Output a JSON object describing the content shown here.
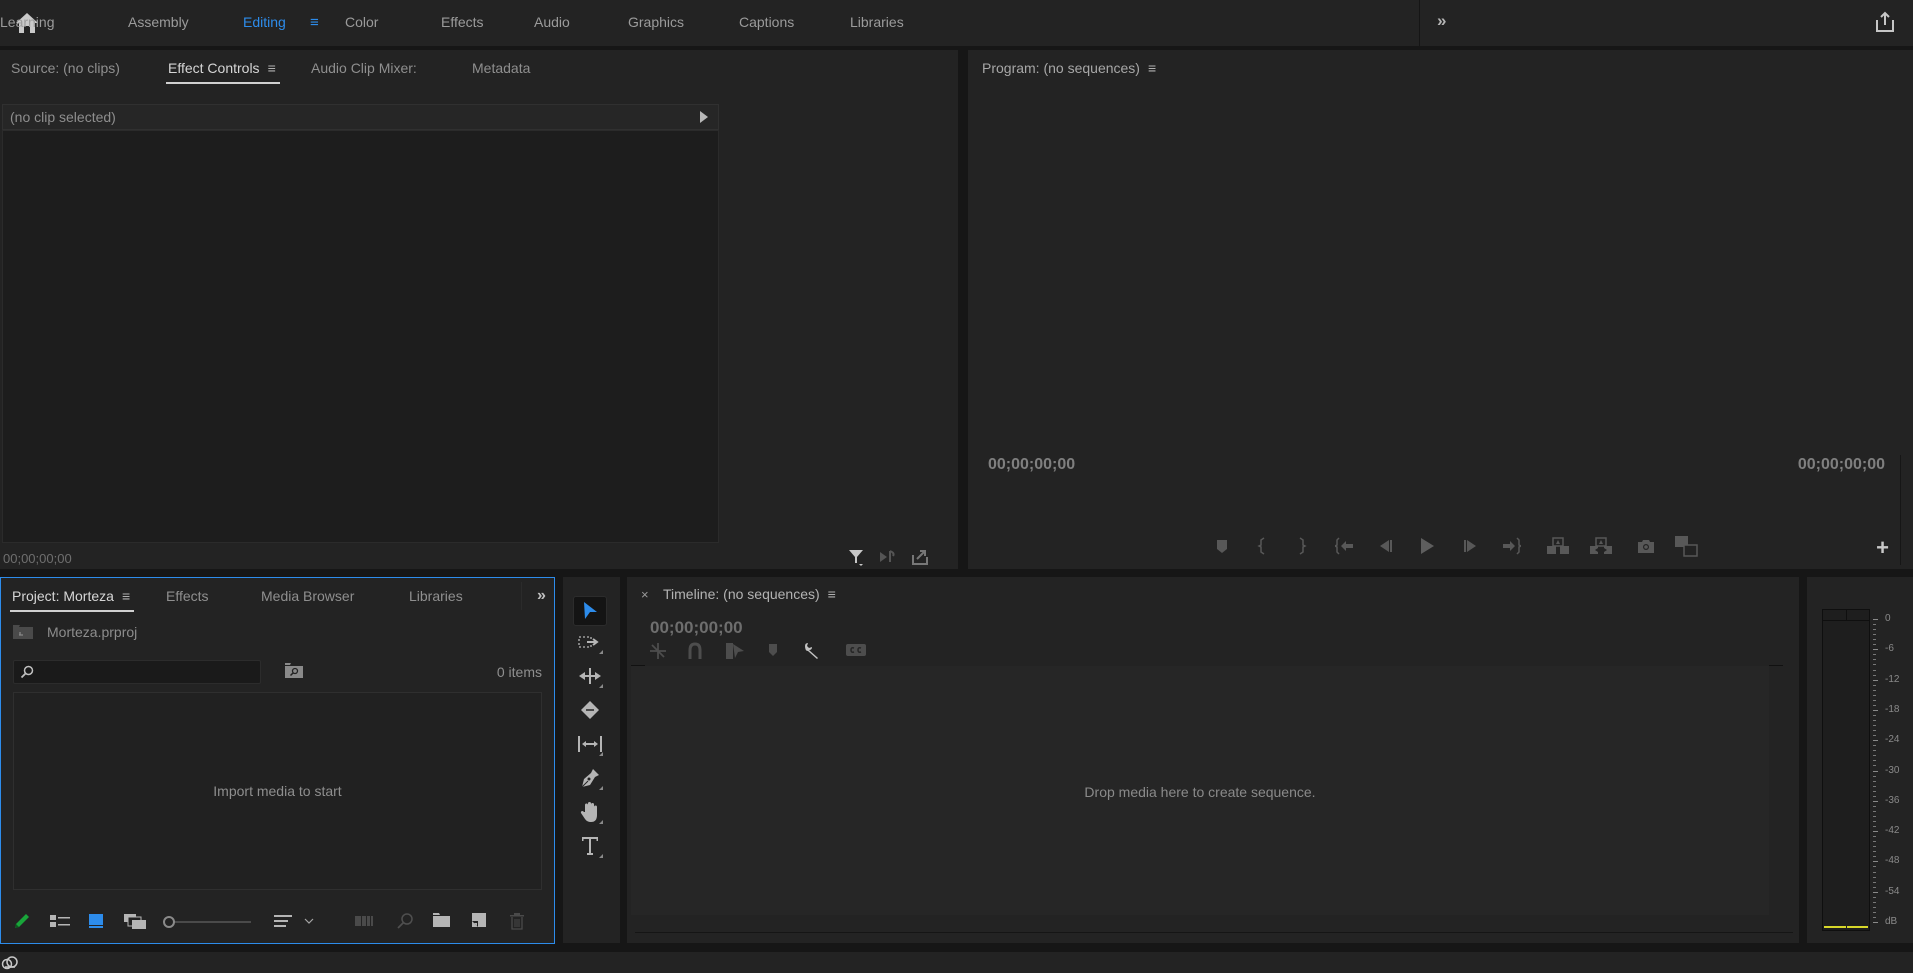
{
  "topbar": {
    "workspaces": [
      {
        "label": "Learning",
        "active": false
      },
      {
        "label": "Assembly",
        "active": false
      },
      {
        "label": "Editing",
        "active": true
      },
      {
        "label": "Color",
        "active": false
      },
      {
        "label": "Effects",
        "active": false
      },
      {
        "label": "Audio",
        "active": false
      },
      {
        "label": "Graphics",
        "active": false
      },
      {
        "label": "Captions",
        "active": false
      },
      {
        "label": "Libraries",
        "active": false
      }
    ],
    "workspace_menu_icon": "hamburger-icon",
    "overflow_icon": "double-chevron-right-icon",
    "home_icon": "home-icon",
    "share_icon": "share-export-icon",
    "accent_color": "#2d8ceb"
  },
  "source_panel": {
    "tabs": [
      {
        "label": "Source: (no clips)",
        "active": false
      },
      {
        "label": "Effect Controls",
        "active": true
      },
      {
        "label": "Audio Clip Mixer:",
        "active": false
      },
      {
        "label": "Metadata",
        "active": false
      }
    ],
    "clip_header": "(no clip selected)",
    "timecode": "00;00;00;00",
    "footer_icons": [
      "filter-icon",
      "play-audio-icon",
      "export-icon"
    ]
  },
  "program_panel": {
    "title": "Program: (no sequences)",
    "timecode_left": "00;00;00;00",
    "timecode_right": "00;00;00;00",
    "transport_buttons": [
      "add-marker-icon",
      "mark-in-icon",
      "mark-out-icon",
      "go-to-in-icon",
      "step-back-icon",
      "play-icon",
      "step-forward-icon",
      "go-to-out-icon",
      "lift-icon",
      "extract-icon",
      "export-frame-icon",
      "comparison-view-icon"
    ],
    "add_button_icon": "plus-icon"
  },
  "project_panel": {
    "tabs": [
      {
        "label": "Project: Morteza",
        "active": true
      },
      {
        "label": "Effects",
        "active": false
      },
      {
        "label": "Media Browser",
        "active": false
      },
      {
        "label": "Libraries",
        "active": false
      }
    ],
    "project_file": "Morteza.prproj",
    "search_placeholder": "",
    "search_value": "",
    "item_count": "0 items",
    "empty_message": "Import media to start",
    "toolbar_icons": [
      "write-protect-pencil-icon",
      "list-view-icon",
      "icon-view-icon",
      "freeform-view-icon",
      "zoom-slider",
      "sort-icon",
      "chevron-down-icon",
      "automate-to-sequence-icon",
      "find-icon",
      "new-bin-icon",
      "new-item-icon",
      "trash-icon"
    ],
    "zoom_slider_value": 0
  },
  "tools_panel": {
    "tools": [
      {
        "name": "selection-tool",
        "active": true
      },
      {
        "name": "track-select-forward-tool",
        "active": false
      },
      {
        "name": "ripple-edit-tool",
        "active": false
      },
      {
        "name": "razor-tool",
        "active": false
      },
      {
        "name": "slip-tool",
        "active": false
      },
      {
        "name": "pen-tool",
        "active": false
      },
      {
        "name": "hand-tool",
        "active": false
      },
      {
        "name": "type-tool",
        "active": false
      }
    ]
  },
  "timeline_panel": {
    "close_label": "×",
    "title": "Timeline: (no sequences)",
    "timecode": "00;00;00;00",
    "tool_icons": [
      "nest-icon",
      "snap-magnet-icon",
      "linked-selection-icon",
      "add-marker-icon",
      "timeline-settings-wrench-icon",
      "captions-cc-icon"
    ],
    "drop_message": "Drop media here to create sequence."
  },
  "audio_meter": {
    "scale_labels": [
      "0",
      "-6",
      "-12",
      "-18",
      "-24",
      "-30",
      "-36",
      "-42",
      "-48",
      "-54",
      "dB"
    ],
    "peak_color": "#d7d72a",
    "channels": 2
  },
  "statusbar": {
    "cc_icon": "creative-cloud-icon"
  }
}
